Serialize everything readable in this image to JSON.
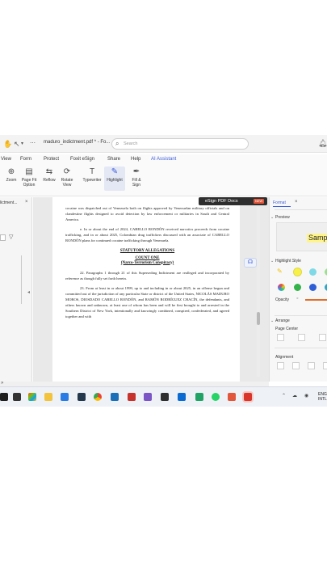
{
  "titlebar": {
    "title": "maduro_indictment.pdf * - Fo...",
    "search_placeholder": "Search",
    "icons": [
      "hand-icon",
      "cursor-icon",
      "search-icon",
      "bell-icon"
    ]
  },
  "menu": [
    "View",
    "Form",
    "Protect",
    "Foxit eSign",
    "Share",
    "Help",
    "AI Assistant"
  ],
  "ribbon": [
    {
      "l1": "Zoom",
      "l2": "",
      "icon": "zoom-icon"
    },
    {
      "l1": "Page Fit",
      "l2": "Option",
      "icon": "page-fit-icon"
    },
    {
      "l1": "Reflow",
      "l2": "",
      "icon": "reflow-icon"
    },
    {
      "l1": "Rotate",
      "l2": "View",
      "icon": "rotate-icon"
    },
    {
      "l1": "Typewriter",
      "l2": "",
      "icon": "typewriter-icon"
    },
    {
      "l1": "Highlight",
      "l2": "",
      "icon": "highlight-icon"
    },
    {
      "l1": "Fill &",
      "l2": "Sign",
      "icon": "fill-sign-icon"
    }
  ],
  "left_panel": {
    "tab_label": "lictment...",
    "close": "×"
  },
  "esign_banner": {
    "label": "eSign PDF Docs",
    "badge": "NEW"
  },
  "document": {
    "p1": "cocaine was dispatched out of Venezuela both on flights approved by Venezuelan military officials and on clandestine flights designed to avoid detection by law enforcement or militaries in South and Central America.",
    "p2": "e.      In or about the end of 2024, CABELLO RONDÓN received narcotics proceeds from cocaine trafficking, and in or about 2025, Colombian drug traffickers discussed with an associate of CABELLO RONDÓN plans for continued cocaine trafficking through Venezuela.",
    "heading": "STATUTORY ALLEGATIONS",
    "count": "COUNT ONE",
    "count_sub": "(Narco-Terrorism Conspiracy)",
    "p3": "22.      Paragraphs 1 through 21 of this Superseding Indictment are realleged and incorporated by reference as though fully set forth herein.",
    "p4": "23.      From at least in or about 1999, up to and including in or about 2025, in an offense begun and committed out of the jurisdiction of any particular State or district of the United States, NICOLÁS MADURO MOROS, DIOSDADO CABELLO RONDÓN, and RAMÓN RODRÍGUEZ CHACÍN, the defendants, and others known and unknown, at least one of whom has been and will be first brought to and arrested in the Southern District of New York, intentionally and knowingly combined, conspired, confederated, and agreed together and with"
  },
  "format_panel": {
    "tab": "Format",
    "close": "×",
    "preview_label": "Preview",
    "preview_text": "Samp",
    "highlight_style": "Highlight Style",
    "opacity": "Opacity",
    "arrange": "Arrange",
    "page_center": "Page Center",
    "alignment": "Alignment",
    "colors": {
      "pen": "#f2c200",
      "yellow": "#f7f048",
      "cyan": "#7fd9e6",
      "green": "#34b34a",
      "blue": "#2f5fd6",
      "accent": "#3b5bdb"
    }
  },
  "status": {
    "left_glyph": "»"
  },
  "taskbar": {
    "apps": [
      "start-icon",
      "search-icon",
      "widgets-icon",
      "edge-icon",
      "file-explorer-icon",
      "store-icon",
      "mail-icon",
      "chrome-icon",
      "media-icon",
      "photos-icon",
      "teams-icon",
      "settings-icon",
      "security-icon",
      "whatsapp-icon",
      "foxit-icon",
      "foxit-pdf-icon"
    ],
    "lang_top": "ENG",
    "lang_bottom": "INTL"
  }
}
